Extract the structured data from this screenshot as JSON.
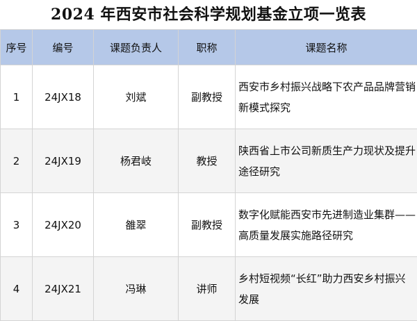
{
  "document": {
    "title": "2024 年西安市社会科学规划基金立项一览表"
  },
  "table": {
    "headers": [
      "序号",
      "编号",
      "课题负责人",
      "职称",
      "课题名称"
    ],
    "rows": [
      {
        "index": "1",
        "code": "24JX18",
        "leader": "刘斌",
        "rank": "副教授",
        "topic": "西安市乡村振兴战略下农产品品牌营销新模式探究"
      },
      {
        "index": "2",
        "code": "24JX19",
        "leader": "杨君岐",
        "rank": "教授",
        "topic": "陕西省上市公司新质生产力现状及提升途径研究"
      },
      {
        "index": "3",
        "code": "24JX20",
        "leader": "雒翠",
        "rank": "副教授",
        "topic": "数字化赋能西安市先进制造业集群——高质量发展实施路径研究"
      },
      {
        "index": "4",
        "code": "24JX21",
        "leader": "冯琳",
        "rank": "讲师",
        "topic": "乡村短视频“长红”助力西安乡村振兴发展"
      }
    ]
  }
}
